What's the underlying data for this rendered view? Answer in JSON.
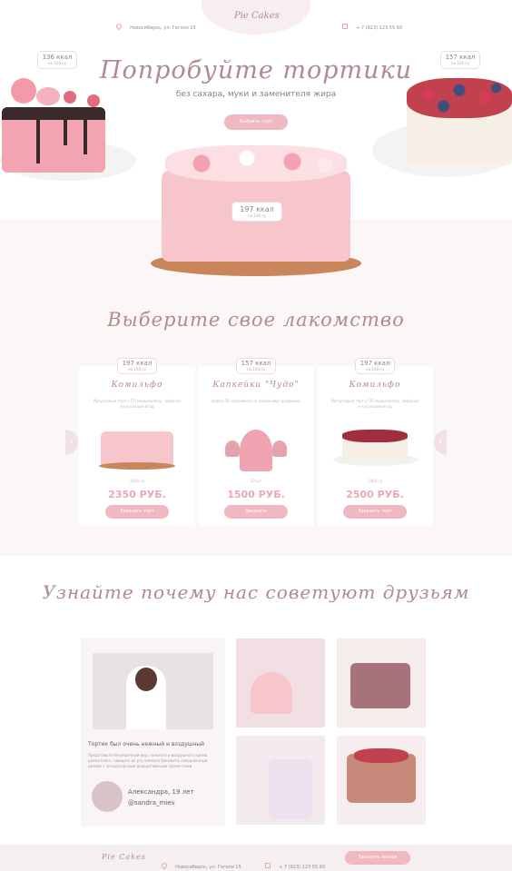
{
  "header": {
    "logo": "Pie Cakes",
    "address": "Новосибирск, ул. Гоголя 15",
    "phone": "+ 7 (923) 123 55 60"
  },
  "hero": {
    "title": "Попробуйте тортики",
    "subtitle": "без сахара, муки и заменителя жира",
    "button": "Выбрать торт",
    "badges": [
      {
        "kcal": "136 ккал",
        "per": "на 100 гр"
      },
      {
        "kcal": "157 ккал",
        "per": "на 100 гр"
      },
      {
        "kcal": "197 ккал",
        "per": "на 100 гр"
      }
    ]
  },
  "catalog": {
    "title": "Выберите свое лакомство",
    "cards": [
      {
        "kcal": "197 ккал",
        "per": "на 100 гр",
        "name": "Комильфо",
        "desc": "Йогуртовый торт с ПП маршмеллоу, зефиром и кусочками ягод",
        "weight": "2500 гр",
        "price": "2350 РУБ.",
        "button": "Заказать торт"
      },
      {
        "kcal": "157 ккал",
        "per": "на 100 гр",
        "name": "Капкейки \"Чудо\"",
        "desc": "Набор ПП капкейков на любой вид праздника",
        "weight": "10 шт",
        "price": "1500 РУБ.",
        "button": "Заказать"
      },
      {
        "kcal": "197 ккал",
        "per": "на 100 гр",
        "name": "Комильфо",
        "desc": "Йогуртовый торт с ПП маршмеллоу, зефиром и кусочками ягод",
        "weight": "2500 гр",
        "price": "2500 РУБ.",
        "button": "Заказать торт"
      }
    ]
  },
  "reviews": {
    "title": "Узнайте почему нас советуют друзьям",
    "headline": "Тортик был очень нежный и воздушный",
    "text": "Представьте безупречный вкус нежного и воздушного крема, ароматного, тающего во рту мягкого бисквита, совершенный дизайн с экзкурсартным декоративными элементами",
    "author": "Александра, 19 лет",
    "handle": "@sandra_miev"
  },
  "footer": {
    "logo": "Pie Cakes",
    "address": "Новосибирск, ул. Гоголя 15",
    "phone": "+ 7 (923) 123 55 60",
    "button": "Заказать звонок"
  },
  "colors": {
    "accent": "#f0b8c0",
    "title": "#b08a8e",
    "price": "#e8aab2",
    "cream": "#f7c6cc"
  }
}
